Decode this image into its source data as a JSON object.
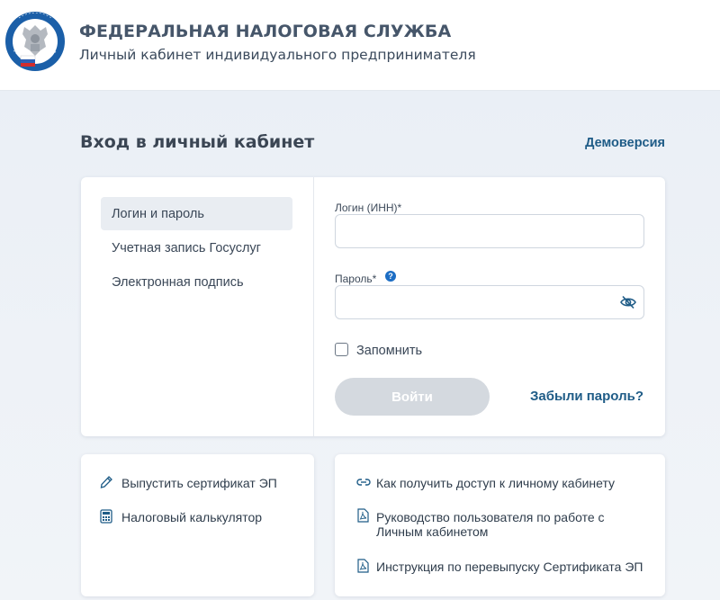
{
  "header": {
    "org_title": "ФЕДЕРАЛЬНАЯ НАЛОГОВАЯ СЛУЖБА",
    "org_subtitle": "Личный кабинет индивидуального предпринимателя",
    "logo_icon": "fns-emblem-icon"
  },
  "page": {
    "title": "Вход в личный кабинет",
    "demo_link": "Демоверсия"
  },
  "login": {
    "methods": [
      {
        "label": "Логин и пароль",
        "active": true
      },
      {
        "label": "Учетная запись Госуслуг",
        "active": false
      },
      {
        "label": "Электронная подпись",
        "active": false
      }
    ],
    "login_label": "Логин (ИНН)*",
    "login_value": "",
    "password_label": "Пароль*",
    "password_value": "",
    "remember_label": "Запомнить",
    "remember_checked": false,
    "submit_label": "Войти",
    "forgot_link": "Забыли пароль?"
  },
  "tools": [
    {
      "icon": "pen-icon",
      "label": "Выпустить сертификат ЭП"
    },
    {
      "icon": "calculator-icon",
      "label": "Налоговый калькулятор"
    }
  ],
  "links": [
    {
      "icon": "link-icon",
      "label": "Как получить доступ к личному кабинету"
    },
    {
      "icon": "pdf-icon",
      "label": "Руководство пользователя по работе с Личным кабинетом"
    },
    {
      "icon": "pdf-icon",
      "label": "Инструкция по перевыпуску Сертификата ЭП"
    }
  ],
  "colors": {
    "accent_link": "#1f5c87",
    "button_disabled": "#d4d9df",
    "help_icon": "#1c6dc4"
  }
}
